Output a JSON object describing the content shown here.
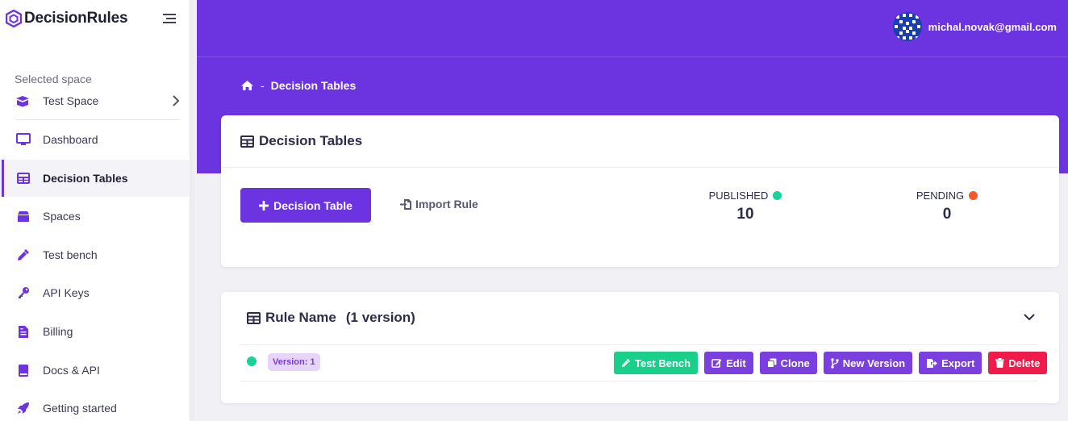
{
  "brand": {
    "name": "DecisionRules"
  },
  "sidebar": {
    "space_caption": "Selected space",
    "space_name": "Test Space",
    "items": [
      {
        "label": "Dashboard",
        "icon": "monitor-icon"
      },
      {
        "label": "Decision Tables",
        "icon": "table-icon",
        "active": true
      },
      {
        "label": "Spaces",
        "icon": "box-icon"
      },
      {
        "label": "Test bench",
        "icon": "eyedropper-icon"
      },
      {
        "label": "API Keys",
        "icon": "key-icon"
      },
      {
        "label": "Billing",
        "icon": "file-invoice-icon"
      },
      {
        "label": "Docs & API",
        "icon": "book-icon"
      },
      {
        "label": "Getting started",
        "icon": "rocket-icon"
      }
    ]
  },
  "header": {
    "user_email": "michal.novak@gmail.com",
    "breadcrumb_separator": "-",
    "breadcrumb_current": "Decision Tables"
  },
  "summary_card": {
    "title": "Decision Tables",
    "add_button_label": "Decision Table",
    "import_label": "Import Rule",
    "stats": [
      {
        "label": "PUBLISHED",
        "value": "10",
        "color": "#1bd19a"
      },
      {
        "label": "PENDING",
        "value": "0",
        "color": "#f5582b"
      }
    ]
  },
  "rule_card": {
    "title": "Rule Name",
    "version_count": "(1 version)",
    "status_color": "#1bd19a",
    "version_badge": "Version: 1",
    "actions": [
      {
        "label": "Test Bench",
        "style": "green",
        "icon": "eyedropper-icon"
      },
      {
        "label": "Edit",
        "style": "purple",
        "icon": "edit-icon"
      },
      {
        "label": "Clone",
        "style": "purple",
        "icon": "clone-icon"
      },
      {
        "label": "New Version",
        "style": "purple",
        "icon": "code-branch-icon"
      },
      {
        "label": "Export",
        "style": "purple",
        "icon": "export-icon"
      },
      {
        "label": "Delete",
        "style": "red",
        "icon": "trash-icon"
      }
    ]
  },
  "colors": {
    "primary": "#6c33e0",
    "success": "#18cf8b",
    "danger": "#f01b4a",
    "badge_bg": "#e6d4fb"
  }
}
